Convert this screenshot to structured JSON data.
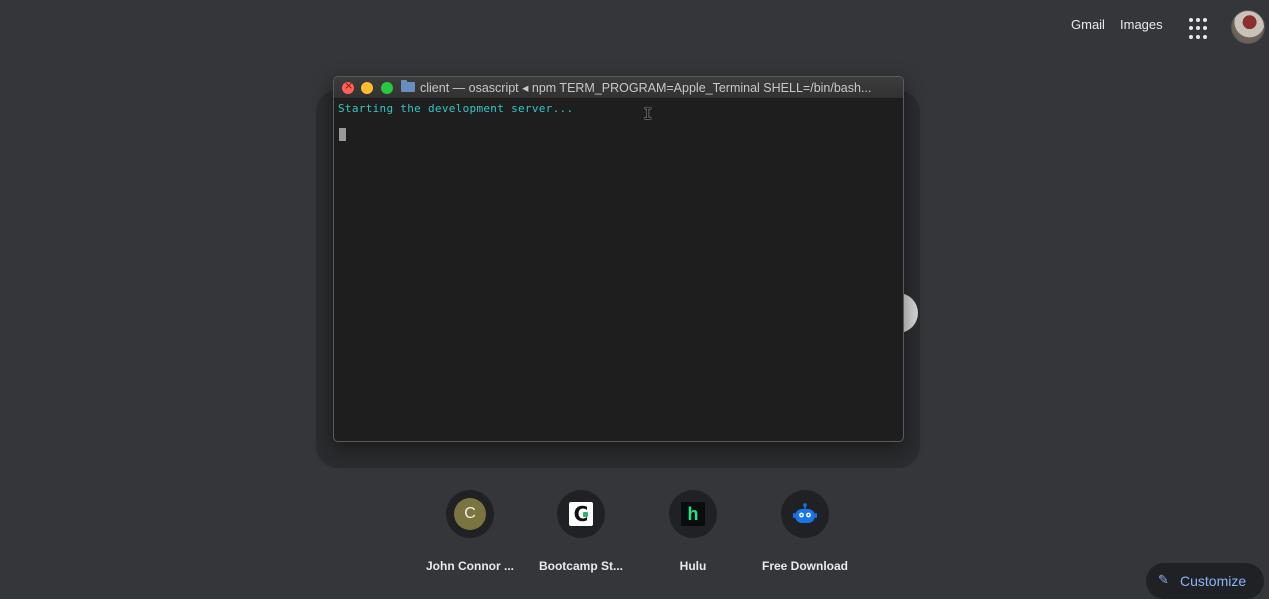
{
  "topbar": {
    "gmail": "Gmail",
    "images": "Images",
    "apps_icon": "apps-grid-icon",
    "avatar_icon": "account-avatar"
  },
  "terminal": {
    "title": "client — osascript ◂ npm TERM_PROGRAM=Apple_Terminal SHELL=/bin/bash...",
    "output_line": "Starting the development server...",
    "colors": {
      "background": "#1e1e1e",
      "output_text": "#33c7c7",
      "close": "#ff5f57",
      "minimize": "#febc2e",
      "maximize": "#28c840"
    }
  },
  "shortcuts": [
    {
      "label": "John Connor ...",
      "icon": "letter-c-icon",
      "initial": "C"
    },
    {
      "label": "Bootcamp St...",
      "icon": "bootcamp-icon",
      "glyph": "C"
    },
    {
      "label": "Hulu",
      "icon": "hulu-icon",
      "glyph": "h"
    },
    {
      "label": "Free Download",
      "icon": "robot-icon"
    }
  ],
  "customize": {
    "label": "Customize",
    "icon": "pencil-icon"
  },
  "colors": {
    "page_background": "#35363a",
    "link": "#8ab4f8",
    "text": "#e8eaed"
  }
}
